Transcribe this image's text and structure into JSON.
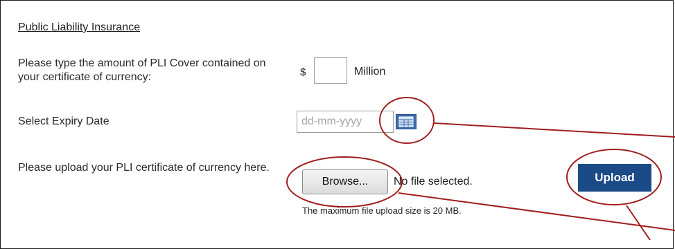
{
  "section": {
    "title": "Public Liability Insurance"
  },
  "pli_cover": {
    "label": "Please type the amount of PLI Cover contained on your certificate of currency:",
    "currency_symbol": "$",
    "unit": "Million",
    "value": ""
  },
  "expiry": {
    "label": "Select Expiry Date",
    "placeholder": "dd-mm-yyyy",
    "calendar_icon": "calendar-icon"
  },
  "upload": {
    "label": "Please upload your PLI certificate of currency here.",
    "browse_label": "Browse...",
    "file_status": "No file selected.",
    "max_size_note": "The maximum file upload size is 20 MB.",
    "upload_label": "Upload"
  },
  "colors": {
    "upload_button": "#1b4b86",
    "annotation": "#a01e1e"
  }
}
